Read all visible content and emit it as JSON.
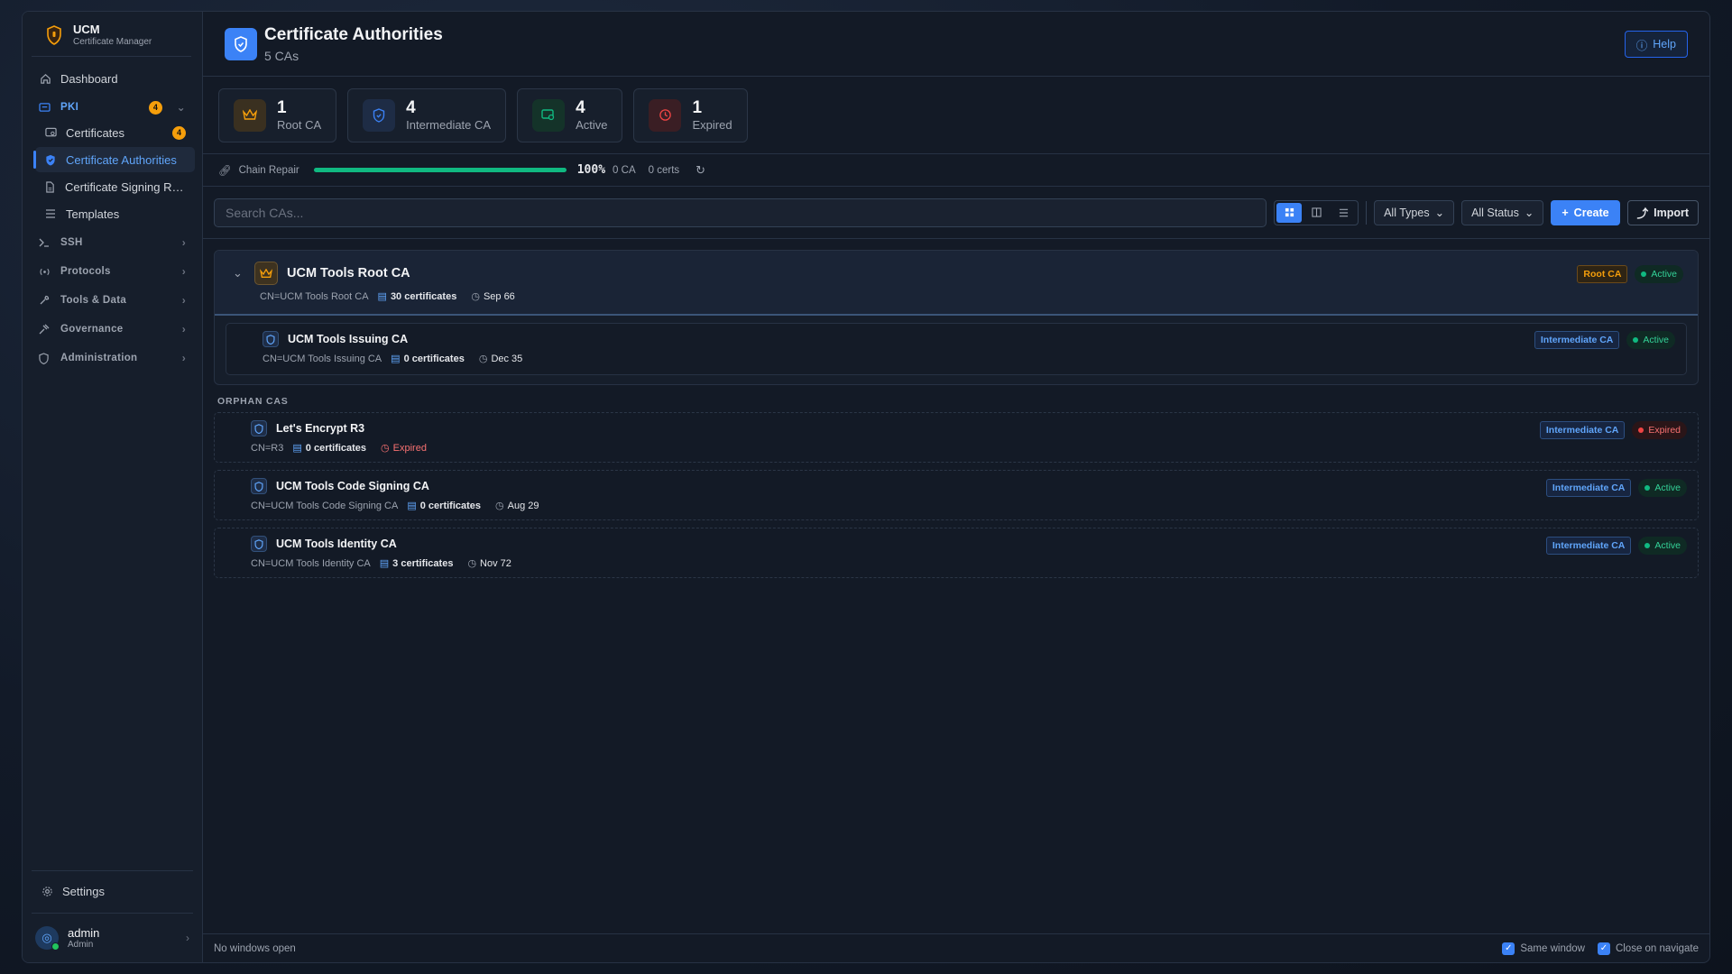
{
  "brand": {
    "name": "UCM",
    "subtitle": "Certificate Manager"
  },
  "sidebar": {
    "dashboard": "Dashboard",
    "pki": {
      "label": "PKI",
      "badge": "4"
    },
    "pki_items": [
      {
        "label": "Certificates",
        "badge": "4"
      },
      {
        "label": "Certificate Authorities"
      },
      {
        "label": "Certificate Signing Requests"
      },
      {
        "label": "Templates"
      }
    ],
    "sections": [
      "SSH",
      "Protocols",
      "Tools & Data",
      "Governance",
      "Administration"
    ],
    "settings": "Settings",
    "user": {
      "name": "admin",
      "role": "Admin"
    }
  },
  "header": {
    "title": "Certificate Authorities",
    "subtitle": "5 CAs",
    "help": "Help"
  },
  "stats": [
    {
      "value": "1",
      "label": "Root CA",
      "color": "#f59e0b"
    },
    {
      "value": "4",
      "label": "Intermediate CA",
      "color": "#3b82f6"
    },
    {
      "value": "4",
      "label": "Active",
      "color": "#10b981"
    },
    {
      "value": "1",
      "label": "Expired",
      "color": "#ef4444"
    }
  ],
  "chain": {
    "label": "Chain Repair",
    "percent": "100%",
    "progress": 1.0,
    "ca": "0 CA",
    "certs": "0 certs"
  },
  "toolbar": {
    "search_placeholder": "Search CAs...",
    "types": "All Types",
    "status": "All Status",
    "create": "Create",
    "import": "Import"
  },
  "root": {
    "name": "UCM Tools Root CA",
    "cn": "CN=UCM Tools Root CA",
    "certs": "30 certificates",
    "date": "Sep 66",
    "type": "Root CA",
    "status": "Active",
    "child": {
      "name": "UCM Tools Issuing CA",
      "cn": "CN=UCM Tools Issuing CA",
      "certs": "0 certificates",
      "date": "Dec 35",
      "type": "Intermediate CA",
      "status": "Active"
    }
  },
  "orphans_title": "ORPHAN CAS",
  "orphans": [
    {
      "name": "Let's Encrypt R3",
      "cn": "CN=R3",
      "certs": "0 certificates",
      "expired": "Expired",
      "type": "Intermediate CA",
      "status": "Expired"
    },
    {
      "name": "UCM Tools Code Signing CA",
      "cn": "CN=UCM Tools Code Signing CA",
      "certs": "0 certificates",
      "date": "Aug 29",
      "type": "Intermediate CA",
      "status": "Active"
    },
    {
      "name": "UCM Tools Identity CA",
      "cn": "CN=UCM Tools Identity CA",
      "certs": "3 certificates",
      "date": "Nov 72",
      "type": "Intermediate CA",
      "status": "Active"
    }
  ],
  "footer": {
    "left": "No windows open",
    "same_window": "Same window",
    "close_nav": "Close on navigate"
  }
}
